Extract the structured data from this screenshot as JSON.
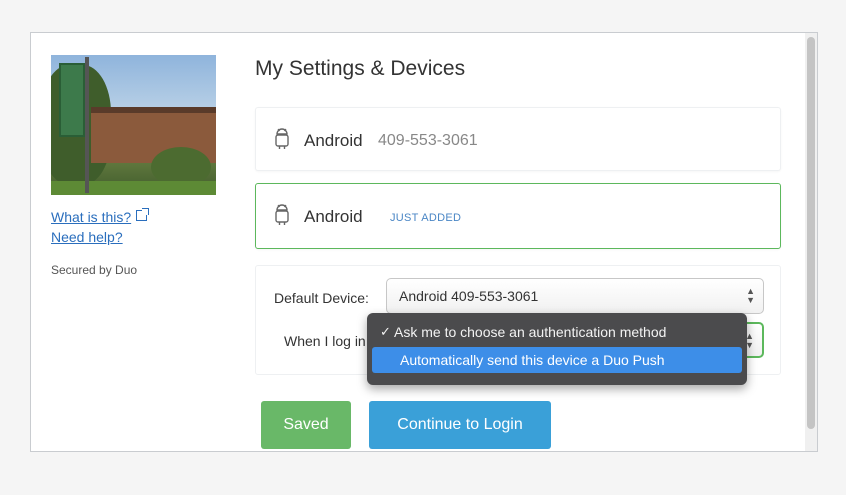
{
  "sidebar": {
    "what_is_this": "What is this?",
    "need_help": "Need help?",
    "secured_by": "Secured by Duo"
  },
  "main": {
    "title": "My Settings & Devices",
    "devices": [
      {
        "name": "Android",
        "phone": "409-553-3061",
        "icon": "android-icon"
      },
      {
        "name": "Android",
        "badge": "JUST ADDED",
        "icon": "android-icon"
      }
    ],
    "settings": {
      "default_device_label": "Default Device:",
      "default_device_value": "Android 409-553-3061",
      "when_login_label": "When I log in"
    },
    "dropdown": {
      "options": [
        {
          "label": "Ask me to choose an authentication method",
          "checked": true
        },
        {
          "label": "Automatically send this device a Duo Push",
          "highlighted": true
        }
      ]
    },
    "buttons": {
      "saved": "Saved",
      "continue": "Continue to Login"
    }
  },
  "colors": {
    "success": "#5cb85c",
    "primary": "#3aa0d8",
    "link": "#2a6ebd",
    "menu_bg": "#4b4b4d",
    "menu_highlight": "#3d8ee8"
  }
}
